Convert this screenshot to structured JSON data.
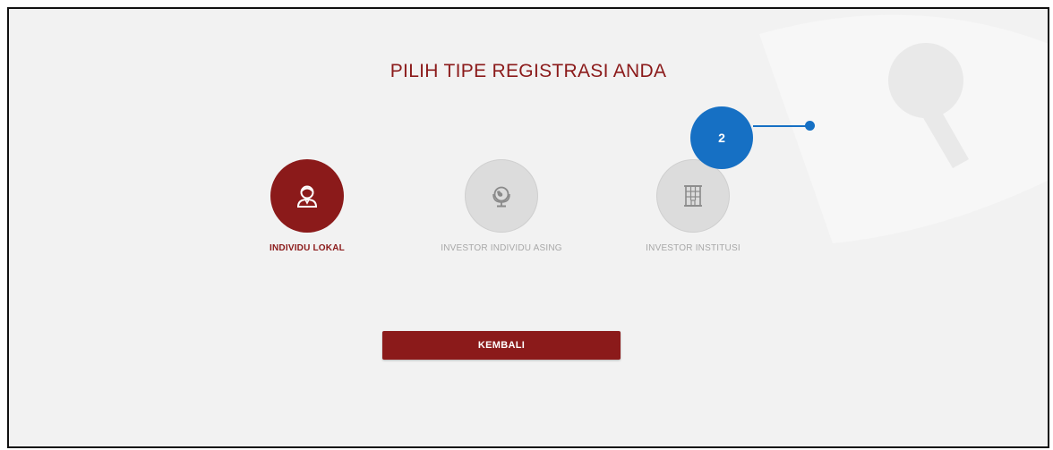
{
  "page": {
    "title": "PILIH TIPE REGISTRASI ANDA"
  },
  "options": [
    {
      "label": "INDIVIDU LOKAL",
      "icon": "person-icon",
      "state": "selected"
    },
    {
      "label": "INVESTOR INDIVIDU ASING",
      "icon": "globe-icon",
      "state": "unselected"
    },
    {
      "label": "INVESTOR INSTITUSI",
      "icon": "building-icon",
      "state": "unselected"
    }
  ],
  "back_button": {
    "label": "KEMBALI"
  },
  "annotation": {
    "number": "2"
  },
  "colors": {
    "brand": "#8b1a1a",
    "inactive_circle": "#dcdcdc",
    "inactive_text": "#a8a8a8",
    "annotation": "#1670c4",
    "background": "#f2f2f2"
  }
}
